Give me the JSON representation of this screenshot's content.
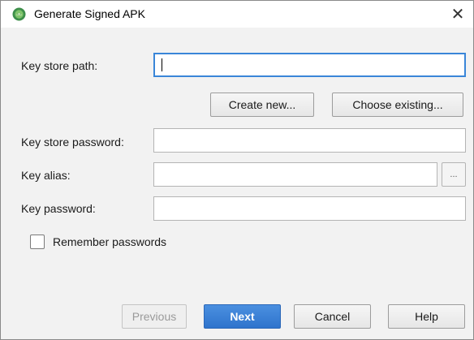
{
  "window": {
    "title": "Generate Signed APK",
    "close_glyph": "✕",
    "icon": "android-studio-icon"
  },
  "form": {
    "key_store_path": {
      "label": "Key store path:",
      "value": ""
    },
    "create_new_label": "Create new...",
    "choose_existing_label": "Choose existing...",
    "key_store_password": {
      "label": "Key store password:",
      "value": ""
    },
    "key_alias": {
      "label": "Key alias:",
      "value": "",
      "browse_label": "..."
    },
    "key_password": {
      "label": "Key password:",
      "value": ""
    },
    "remember_passwords": {
      "label": "Remember passwords",
      "checked": false
    }
  },
  "footer": {
    "previous_label": "Previous",
    "next_label": "Next",
    "cancel_label": "Cancel",
    "help_label": "Help"
  },
  "colors": {
    "accent": "#3a86d8",
    "primary_button": "#3579d3",
    "background": "#f2f2f2"
  }
}
